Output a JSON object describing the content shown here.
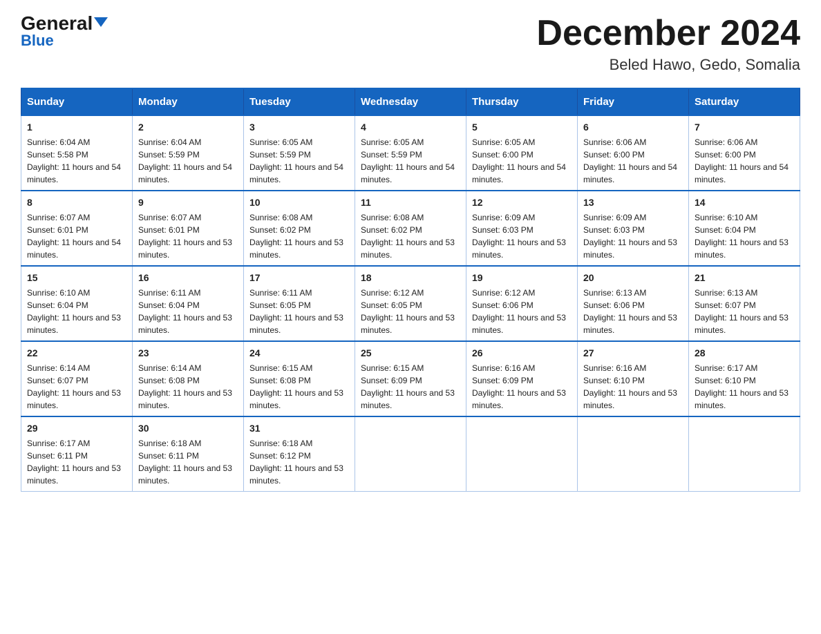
{
  "header": {
    "logo_general": "General",
    "logo_blue": "Blue",
    "month_title": "December 2024",
    "location": "Beled Hawo, Gedo, Somalia"
  },
  "days_of_week": [
    "Sunday",
    "Monday",
    "Tuesday",
    "Wednesday",
    "Thursday",
    "Friday",
    "Saturday"
  ],
  "weeks": [
    [
      {
        "day": "1",
        "sunrise": "6:04 AM",
        "sunset": "5:58 PM",
        "daylight": "11 hours and 54 minutes."
      },
      {
        "day": "2",
        "sunrise": "6:04 AM",
        "sunset": "5:59 PM",
        "daylight": "11 hours and 54 minutes."
      },
      {
        "day": "3",
        "sunrise": "6:05 AM",
        "sunset": "5:59 PM",
        "daylight": "11 hours and 54 minutes."
      },
      {
        "day": "4",
        "sunrise": "6:05 AM",
        "sunset": "5:59 PM",
        "daylight": "11 hours and 54 minutes."
      },
      {
        "day": "5",
        "sunrise": "6:05 AM",
        "sunset": "6:00 PM",
        "daylight": "11 hours and 54 minutes."
      },
      {
        "day": "6",
        "sunrise": "6:06 AM",
        "sunset": "6:00 PM",
        "daylight": "11 hours and 54 minutes."
      },
      {
        "day": "7",
        "sunrise": "6:06 AM",
        "sunset": "6:00 PM",
        "daylight": "11 hours and 54 minutes."
      }
    ],
    [
      {
        "day": "8",
        "sunrise": "6:07 AM",
        "sunset": "6:01 PM",
        "daylight": "11 hours and 54 minutes."
      },
      {
        "day": "9",
        "sunrise": "6:07 AM",
        "sunset": "6:01 PM",
        "daylight": "11 hours and 53 minutes."
      },
      {
        "day": "10",
        "sunrise": "6:08 AM",
        "sunset": "6:02 PM",
        "daylight": "11 hours and 53 minutes."
      },
      {
        "day": "11",
        "sunrise": "6:08 AM",
        "sunset": "6:02 PM",
        "daylight": "11 hours and 53 minutes."
      },
      {
        "day": "12",
        "sunrise": "6:09 AM",
        "sunset": "6:03 PM",
        "daylight": "11 hours and 53 minutes."
      },
      {
        "day": "13",
        "sunrise": "6:09 AM",
        "sunset": "6:03 PM",
        "daylight": "11 hours and 53 minutes."
      },
      {
        "day": "14",
        "sunrise": "6:10 AM",
        "sunset": "6:04 PM",
        "daylight": "11 hours and 53 minutes."
      }
    ],
    [
      {
        "day": "15",
        "sunrise": "6:10 AM",
        "sunset": "6:04 PM",
        "daylight": "11 hours and 53 minutes."
      },
      {
        "day": "16",
        "sunrise": "6:11 AM",
        "sunset": "6:04 PM",
        "daylight": "11 hours and 53 minutes."
      },
      {
        "day": "17",
        "sunrise": "6:11 AM",
        "sunset": "6:05 PM",
        "daylight": "11 hours and 53 minutes."
      },
      {
        "day": "18",
        "sunrise": "6:12 AM",
        "sunset": "6:05 PM",
        "daylight": "11 hours and 53 minutes."
      },
      {
        "day": "19",
        "sunrise": "6:12 AM",
        "sunset": "6:06 PM",
        "daylight": "11 hours and 53 minutes."
      },
      {
        "day": "20",
        "sunrise": "6:13 AM",
        "sunset": "6:06 PM",
        "daylight": "11 hours and 53 minutes."
      },
      {
        "day": "21",
        "sunrise": "6:13 AM",
        "sunset": "6:07 PM",
        "daylight": "11 hours and 53 minutes."
      }
    ],
    [
      {
        "day": "22",
        "sunrise": "6:14 AM",
        "sunset": "6:07 PM",
        "daylight": "11 hours and 53 minutes."
      },
      {
        "day": "23",
        "sunrise": "6:14 AM",
        "sunset": "6:08 PM",
        "daylight": "11 hours and 53 minutes."
      },
      {
        "day": "24",
        "sunrise": "6:15 AM",
        "sunset": "6:08 PM",
        "daylight": "11 hours and 53 minutes."
      },
      {
        "day": "25",
        "sunrise": "6:15 AM",
        "sunset": "6:09 PM",
        "daylight": "11 hours and 53 minutes."
      },
      {
        "day": "26",
        "sunrise": "6:16 AM",
        "sunset": "6:09 PM",
        "daylight": "11 hours and 53 minutes."
      },
      {
        "day": "27",
        "sunrise": "6:16 AM",
        "sunset": "6:10 PM",
        "daylight": "11 hours and 53 minutes."
      },
      {
        "day": "28",
        "sunrise": "6:17 AM",
        "sunset": "6:10 PM",
        "daylight": "11 hours and 53 minutes."
      }
    ],
    [
      {
        "day": "29",
        "sunrise": "6:17 AM",
        "sunset": "6:11 PM",
        "daylight": "11 hours and 53 minutes."
      },
      {
        "day": "30",
        "sunrise": "6:18 AM",
        "sunset": "6:11 PM",
        "daylight": "11 hours and 53 minutes."
      },
      {
        "day": "31",
        "sunrise": "6:18 AM",
        "sunset": "6:12 PM",
        "daylight": "11 hours and 53 minutes."
      },
      null,
      null,
      null,
      null
    ]
  ]
}
